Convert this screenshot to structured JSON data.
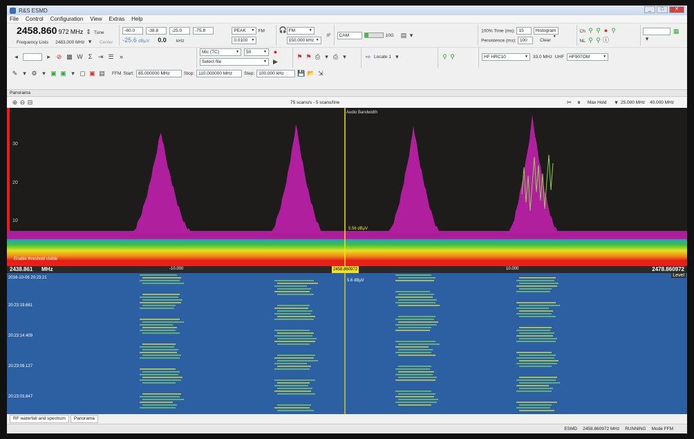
{
  "window": {
    "title": "R&S ESMD"
  },
  "menu": [
    "File",
    "Control",
    "Configuration",
    "View",
    "Extras",
    "Help"
  ],
  "toolbar": {
    "frequency_main": "2458.860",
    "frequency_fine": "972",
    "frequency_unit": "MHz",
    "tune_label": "Tune",
    "center_label": "Center",
    "frequency_lists_label": "Frequency Lists",
    "step_value": "2483.000 MHz",
    "level_scale": [
      "-60.0",
      "-38.8",
      "-25.0",
      "-75.8"
    ],
    "level_value": "-25.6",
    "level_unit": "dBµV",
    "offset_value": "0.0",
    "offset_unit": "kHz",
    "detector_label": "PEAK",
    "measure_time": "0.0100",
    "fm_label": "FM",
    "demod_value": "FM",
    "bandwidth_value": "150.000 kHz",
    "if_label": "IF",
    "gain_value": "CAM",
    "db_label": "10G",
    "time_label": "100% Time (ms):",
    "time_value": "15",
    "persistence_label": "Persistence (ms):",
    "persistence_value": "100",
    "histogram_label": "Histogram",
    "clear_label": "Clear",
    "ch_label": "Ch",
    "nl_label": "NL",
    "rec_source": "Mic (TC)",
    "rec_value": "50",
    "select_file": "Select file",
    "locate_label": "Locate 1",
    "hf_label": "HF HRC10",
    "hf_freq": "33.0 MHz",
    "uhf_label": "UHF",
    "uhf_value": "HF907OM",
    "ffm_label": "FFM",
    "start_label": "Start:",
    "start_value": "85.000000 MHz",
    "stop_label": "Stop:",
    "stop_value": "110.000000 MHz",
    "step_label": "Step:",
    "step_field": "100.000 kHz"
  },
  "panel": {
    "title": "Panorama",
    "scan_info": "75 scans/s - 5 scans/line",
    "hold_mode": "Max Hold",
    "span_left": "25.000 MHz",
    "span_right": "40.000 MHz"
  },
  "spectrum": {
    "y_ticks": [
      "30",
      "20",
      "10"
    ],
    "audio_bw_label": "Audio Bandwidth",
    "marker_level": "5.56 dBµV",
    "threshold_label": "Enable threshold visible"
  },
  "axis": {
    "start_freq": "2438.861",
    "start_unit": "MHz",
    "tick_left": "-10.000",
    "center_freq": "2458.860972",
    "tick_right": "10.000",
    "stop_freq": "2478.860972",
    "level_btn": "Level"
  },
  "waterfall": {
    "date_label": "2016-10-06 20:23:21",
    "marker_level": "5.6 dBµV",
    "timestamps": [
      "20:23:19.661",
      "20:23:14.409",
      "20:23:09.127",
      "20:23:03.847"
    ]
  },
  "tabs": [
    "RF waterfall and spectrum",
    "Panorama"
  ],
  "status": {
    "device": "ESMD",
    "freq": "2458.860972 MHz",
    "state": "RUNNING",
    "mode": "Mode FFM"
  },
  "colors": {
    "spectrum_bg": "#1e1b1b",
    "signal": "#b0209e",
    "noise_red": "#e8201a",
    "waterfall_bg": "#2d5fa3",
    "marker": "#f2e11a"
  }
}
